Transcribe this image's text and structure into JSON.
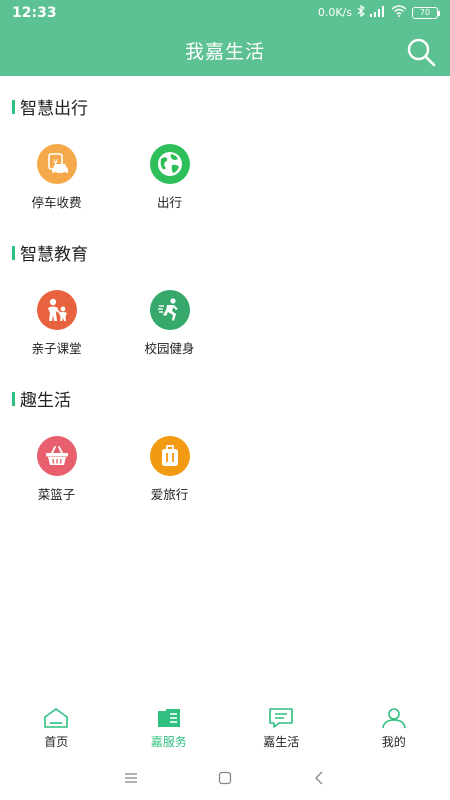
{
  "status_bar": {
    "time": "12:33",
    "speed": "0.0K/s",
    "battery": "70"
  },
  "header": {
    "title": "我嘉生活"
  },
  "sections": [
    {
      "title": "智慧出行",
      "items": [
        {
          "label": "停车收费",
          "icon": "parking-fee-icon",
          "color": "#f5a94a"
        },
        {
          "label": "出行",
          "icon": "globe-icon",
          "color": "#2fbf5a"
        }
      ]
    },
    {
      "title": "智慧教育",
      "items": [
        {
          "label": "亲子课堂",
          "icon": "parent-child-icon",
          "color": "#e8623f"
        },
        {
          "label": "校园健身",
          "icon": "runner-icon",
          "color": "#37a86b"
        }
      ]
    },
    {
      "title": "趣生活",
      "items": [
        {
          "label": "菜篮子",
          "icon": "basket-icon",
          "color": "#e8606e"
        },
        {
          "label": "爱旅行",
          "icon": "luggage-icon",
          "color": "#f29a12"
        }
      ]
    }
  ],
  "bottom_nav": {
    "items": [
      {
        "label": "首页",
        "icon": "home-icon",
        "active": false
      },
      {
        "label": "嘉服务",
        "icon": "services-icon",
        "active": true
      },
      {
        "label": "嘉生活",
        "icon": "chat-icon",
        "active": false
      },
      {
        "label": "我的",
        "icon": "user-icon",
        "active": false
      }
    ]
  },
  "colors": {
    "primary": "#5cc193",
    "accent": "#2fbf7f"
  }
}
